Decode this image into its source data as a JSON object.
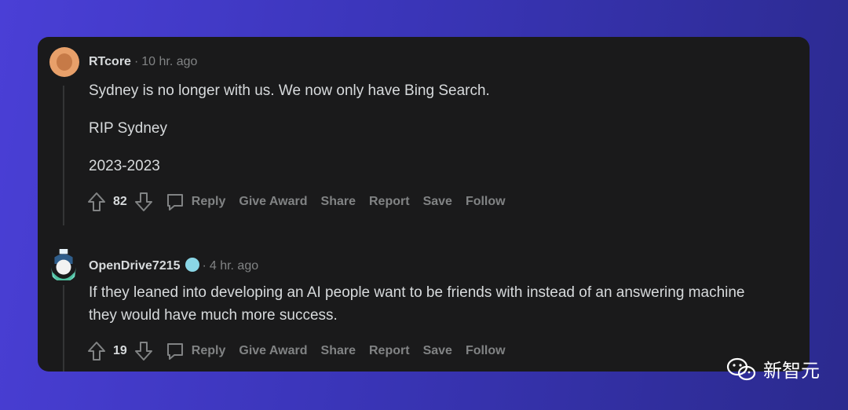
{
  "comments": [
    {
      "author": "RTcore",
      "separator": "·",
      "time": "10 hr. ago",
      "paragraphs": [
        "Sydney is no longer with us. We now only have Bing Search.",
        "RIP Sydney",
        "2023-2023"
      ],
      "score": "82",
      "actions": {
        "reply": "Reply",
        "award": "Give Award",
        "share": "Share",
        "report": "Report",
        "save": "Save",
        "follow": "Follow"
      }
    },
    {
      "author": "OpenDrive7215",
      "separator": "·",
      "time": "4 hr. ago",
      "paragraphs": [
        "If they leaned into developing an AI people want to be friends with instead of an answering machine they would have much more success."
      ],
      "score": "19",
      "actions": {
        "reply": "Reply",
        "award": "Give Award",
        "share": "Share",
        "report": "Report",
        "save": "Save",
        "follow": "Follow"
      }
    }
  ],
  "watermark": {
    "text": "新智元",
    "icon": "wechat-icon"
  },
  "colors": {
    "card": "#1a1a1b",
    "text": "#d7dadc",
    "muted": "#818384",
    "bg_start": "#4a3fd6",
    "bg_end": "#2b2a8e"
  }
}
